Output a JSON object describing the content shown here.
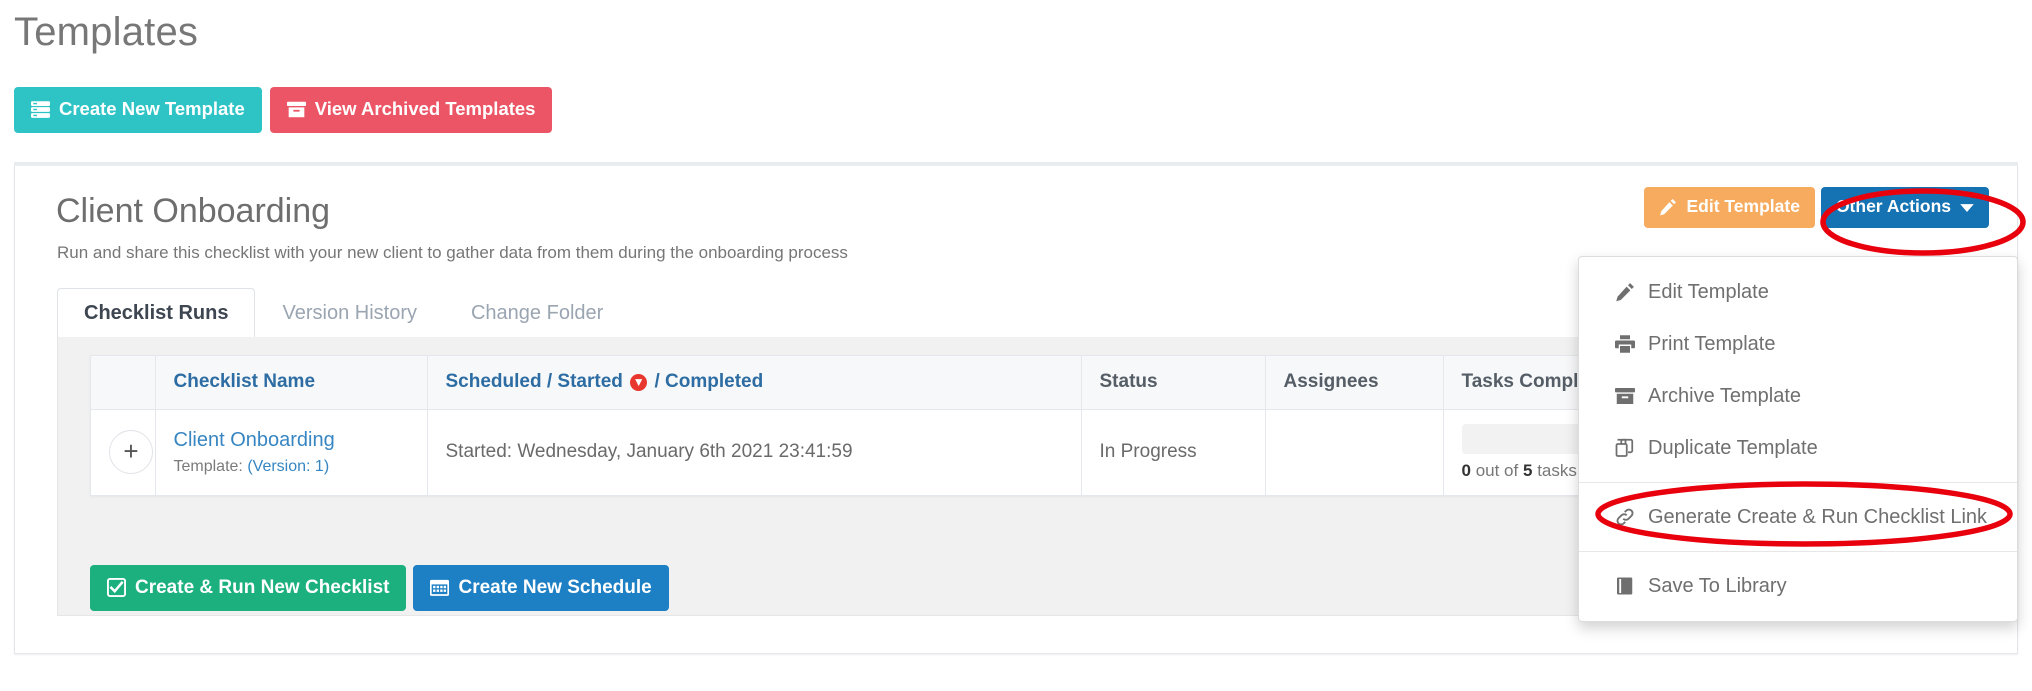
{
  "page": {
    "title": "Templates"
  },
  "toolbar": {
    "create_new_template": "Create New Template",
    "view_archived_templates": "View Archived Templates"
  },
  "template": {
    "name": "Client Onboarding",
    "description": "Run and share this checklist with your new client to gather data from them during the onboarding process",
    "edit_button": "Edit Template",
    "other_actions_button": "Other Actions"
  },
  "tabs": [
    {
      "label": "Checklist Runs",
      "active": true
    },
    {
      "label": "Version History",
      "active": false
    },
    {
      "label": "Change Folder",
      "active": false
    }
  ],
  "table": {
    "headers": {
      "expand": "",
      "checklist_name": "Checklist Name",
      "scheduled": "Scheduled",
      "sep1": "/",
      "started": "Started",
      "sort_icon": "sort-desc-icon",
      "sep2": "/",
      "completed": "Completed",
      "status": "Status",
      "assignees": "Assignees",
      "tasks_completed": "Tasks Completed"
    },
    "rows": [
      {
        "expand": "+",
        "name": "Client Onboarding",
        "sub_prefix": "Template:",
        "sub_link": "(Version: 1)",
        "schedule": "Started: Wednesday, January 6th 2021 23:41:59",
        "status": "In Progress",
        "assignees": "",
        "tasks_done": "0",
        "tasks_mid": "out of",
        "tasks_total": "5",
        "tasks_suffix": "tasks complete",
        "progress_percent": 0
      }
    ]
  },
  "footer_actions": {
    "create_run": "Create & Run New Checklist",
    "create_schedule": "Create New Schedule"
  },
  "dropdown": {
    "items": [
      {
        "icon": "pencil-icon",
        "label": "Edit Template"
      },
      {
        "icon": "printer-icon",
        "label": "Print Template"
      },
      {
        "icon": "archive-icon",
        "label": "Archive Template"
      },
      {
        "icon": "copy-icon",
        "label": "Duplicate Template"
      },
      {
        "icon": "link-icon",
        "label": "Generate Create & Run Checklist Link"
      },
      {
        "icon": "book-icon",
        "label": "Save To Library"
      }
    ]
  },
  "annotations": [
    {
      "name": "highlight-other-actions",
      "target": "Other Actions"
    },
    {
      "name": "highlight-generate-link",
      "target": "Generate Create & Run Checklist Link"
    }
  ],
  "colors": {
    "teal": "#2ec4c6",
    "red": "#ec5565",
    "green": "#1bb07d",
    "blue": "#1d7fc4",
    "orange": "#f6ab5e",
    "link": "#3786c2",
    "annotation_red": "#e8000d"
  }
}
